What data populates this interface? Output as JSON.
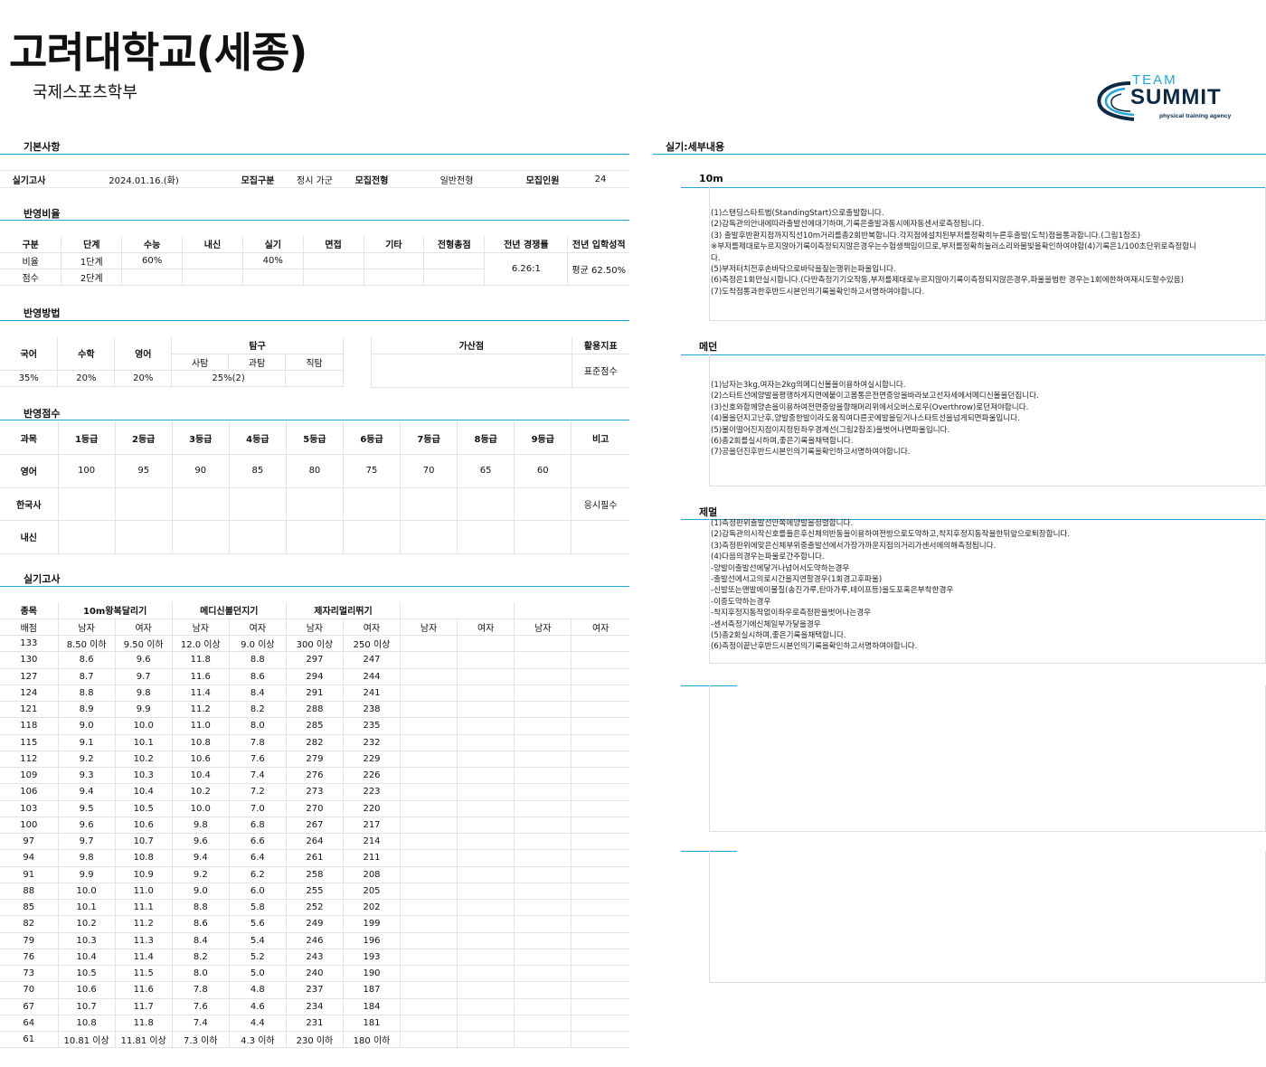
{
  "header": {
    "title": "고려대학교(세종)",
    "subtitle": "국제스포츠학부",
    "logo_top": "TEAM",
    "logo_main": "SUMMIT",
    "logo_sub": "physical training agency"
  },
  "sections": {
    "basic": "기본사항",
    "ratio": "반영비율",
    "method": "반영방법",
    "score": "반영점수",
    "exam": "실기고사",
    "detail": "실기:세부내용"
  },
  "basic": {
    "label_exam": "실기고사",
    "exam_date": "2024.01.16.(화)",
    "label_type": "모집구분",
    "type": "정시 가군",
    "label_track": "모집전형",
    "track": "일반전형",
    "label_count": "모집인원",
    "count": "24"
  },
  "ratio": {
    "headers": [
      "구분",
      "단계",
      "수능",
      "내신",
      "실기",
      "면접",
      "기타",
      "전형총점",
      "전년 경쟁률",
      "전년 입학성적"
    ],
    "row1": [
      "비율",
      "1단계",
      "60%",
      "",
      "40%",
      "",
      "",
      ""
    ],
    "row2": [
      "점수",
      "2단계",
      "",
      "",
      "",
      "",
      "",
      ""
    ],
    "competition": "6.26:1",
    "prev_score": "평균 62.50%"
  },
  "method": {
    "headers": [
      "국어",
      "수학",
      "영어",
      "탐구"
    ],
    "sub_headers": [
      "사탐",
      "과탐",
      "직탐"
    ],
    "values": [
      "35%",
      "20%",
      "20%",
      "25%(2)"
    ],
    "bonus_label": "가산점",
    "index_label": "활용지표",
    "index_value": "표준점수"
  },
  "score": {
    "headers": [
      "과목",
      "1등급",
      "2등급",
      "3등급",
      "4등급",
      "5등급",
      "6등급",
      "7등급",
      "8등급",
      "9등급",
      "비고"
    ],
    "english": [
      "영어",
      "100",
      "95",
      "90",
      "85",
      "80",
      "75",
      "70",
      "65",
      "60",
      ""
    ],
    "history": [
      "한국사",
      "",
      "",
      "",
      "",
      "",
      "",
      "",
      "",
      "",
      "응시필수"
    ],
    "gpa": [
      "내신",
      "",
      "",
      "",
      "",
      "",
      "",
      "",
      "",
      "",
      ""
    ]
  },
  "exam": {
    "label_event": "종목",
    "events": [
      "10m왕복달리기",
      "메디신볼던지기",
      "제자리멀리뛰기"
    ],
    "label_points": "배점",
    "male": "남자",
    "female": "여자",
    "rows": [
      [
        "133",
        "8.50 이하",
        "9.50 이하",
        "12.0 이상",
        "9.0 이상",
        "300 이상",
        "250 이상"
      ],
      [
        "130",
        "8.6",
        "9.6",
        "11.8",
        "8.8",
        "297",
        "247"
      ],
      [
        "127",
        "8.7",
        "9.7",
        "11.6",
        "8.6",
        "294",
        "244"
      ],
      [
        "124",
        "8.8",
        "9.8",
        "11.4",
        "8.4",
        "291",
        "241"
      ],
      [
        "121",
        "8.9",
        "9.9",
        "11.2",
        "8.2",
        "288",
        "238"
      ],
      [
        "118",
        "9.0",
        "10.0",
        "11.0",
        "8.0",
        "285",
        "235"
      ],
      [
        "115",
        "9.1",
        "10.1",
        "10.8",
        "7.8",
        "282",
        "232"
      ],
      [
        "112",
        "9.2",
        "10.2",
        "10.6",
        "7.6",
        "279",
        "229"
      ],
      [
        "109",
        "9.3",
        "10.3",
        "10.4",
        "7.4",
        "276",
        "226"
      ],
      [
        "106",
        "9.4",
        "10.4",
        "10.2",
        "7.2",
        "273",
        "223"
      ],
      [
        "103",
        "9.5",
        "10.5",
        "10.0",
        "7.0",
        "270",
        "220"
      ],
      [
        "100",
        "9.6",
        "10.6",
        "9.8",
        "6.8",
        "267",
        "217"
      ],
      [
        "97",
        "9.7",
        "10.7",
        "9.6",
        "6.6",
        "264",
        "214"
      ],
      [
        "94",
        "9.8",
        "10.8",
        "9.4",
        "6.4",
        "261",
        "211"
      ],
      [
        "91",
        "9.9",
        "10.9",
        "9.2",
        "6.2",
        "258",
        "208"
      ],
      [
        "88",
        "10.0",
        "11.0",
        "9.0",
        "6.0",
        "255",
        "205"
      ],
      [
        "85",
        "10.1",
        "11.1",
        "8.8",
        "5.8",
        "252",
        "202"
      ],
      [
        "82",
        "10.2",
        "11.2",
        "8.6",
        "5.6",
        "249",
        "199"
      ],
      [
        "79",
        "10.3",
        "11.3",
        "8.4",
        "5.4",
        "246",
        "196"
      ],
      [
        "76",
        "10.4",
        "11.4",
        "8.2",
        "5.2",
        "243",
        "193"
      ],
      [
        "73",
        "10.5",
        "11.5",
        "8.0",
        "5.0",
        "240",
        "190"
      ],
      [
        "70",
        "10.6",
        "11.6",
        "7.8",
        "4.8",
        "237",
        "187"
      ],
      [
        "67",
        "10.7",
        "11.7",
        "7.6",
        "4.6",
        "234",
        "184"
      ],
      [
        "64",
        "10.8",
        "11.8",
        "7.4",
        "4.4",
        "231",
        "181"
      ],
      [
        "61",
        "10.81 이상",
        "11.81 이상",
        "7.3 이하",
        "4.3 이하",
        "230 이하",
        "180 이하"
      ]
    ]
  },
  "details": [
    {
      "title": "10m",
      "lines": [
        "(1)스탠딩스타트법(StandingStart)으로출발합니다.",
        "(2)감독관의안내에따라출발선에대기하며,기록은출발과동시에자동센서로측정됩니다.",
        "(3) 출발후반환지점까지직선10m거리를총2회반복합니다.각지점에설치된부저를정확히누른후출발(도착)점을통과합니다.(그림1참조)",
        "※부저를제대로누르지않아기록이측정되지않은경우는수험생책임이므로,부저를정확히눌러소리와불빛을확인하여야함(4)기록은1/100초단위로측정합니",
        "다.",
        "(5)부저터치전후손바닥으로바닥을짚는행위는파울입니다.",
        "(6)측정은1회만실시합니다.(다만측정기기오작동,부저를제대로누르지않아기록이측정되지않은경우,파울을범한 경우는1회에한하여재시도할수있음)",
        "(7)도착점통과한후반드시본인의기록을확인하고서명하여야합니다."
      ]
    },
    {
      "title": "메던",
      "lines": [
        "(1)남자는3kg,여자는2kg의메디신볼을이용하여실시합니다.",
        "(2)스타트선에양발을평행하게지면에붙이고몸통은전면중앙을바라보고선자세에서메디신볼을던집니다.",
        "(3)신호와함께양손을이용하여전면중앙을향해머리위에서오버스로우(Overthrow)로던져야합니다.",
        "(4)볼을던지고난후,양발중한발이라도움직여다른곳에발을딛거나스타트선을넘게되면파울입니다.",
        "(5)볼이떨어진지점이지정된좌우경계선(그림2참조)을벗어나면파울입니다.",
        "(6)총2회를실시하며,좋은기록을채택합니다.",
        "(7)공을던진후반드시본인의기록을확인하고서명하여야합니다."
      ]
    },
    {
      "title": "제멀",
      "lines": [
        "(1)측정판위출발선안쪽에양발을정렬합니다.",
        "(2)감독관의시작신호를들은후신체의반동을이용하여전방으로도약하고,착지후정지동작을한뒤앞으로퇴장합니다.",
        "(3)측정판위에맞은신체부위중출발선에서가장가까운지점의거리가센서에의해측정됩니다.",
        "(4)다음의경우는파울로간주합니다.",
        "-양발이출발선에닿거나넘어서도약하는경우",
        "-출발선에서고의로시간을지연할경우(1회경고후파울)",
        "-신발또는맨발에이물질(송진가루,탄마가루,테이프등)을도포혹은부착한경우",
        "-이중도약하는경우",
        "-착지후정지동작없이좌우로측정판을벗어나는경우",
        "-센서측정기에신체일부가닿을경우",
        "(5)총2회실시하며,좋은기록을채택합니다.",
        "(6)측정이끝난후반드시본인의기록을확인하고서명하여야합니다."
      ]
    }
  ]
}
